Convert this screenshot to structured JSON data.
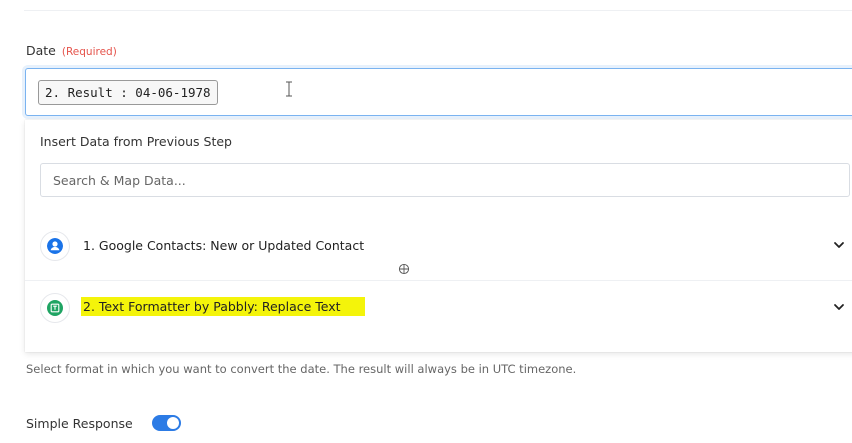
{
  "date_field": {
    "label": "Date",
    "required_text": "(Required)",
    "pill_value": "2. Result : 04-06-1978"
  },
  "dropdown": {
    "title": "Insert Data from Previous Step",
    "search_placeholder": "Search & Map Data...",
    "steps": [
      {
        "label": "1. Google Contacts: New or Updated Contact",
        "icon": "google-contacts-icon",
        "icon_color": "#1a73e8",
        "expanded": false
      },
      {
        "label": "2. Text Formatter by Pabbly: Replace Text",
        "icon": "text-formatter-icon",
        "icon_color": "#1fa463",
        "highlight_color": "#f4f40a",
        "expanded": false
      }
    ]
  },
  "help_text": "Select format in which you want to convert the date. The result will always be in UTC timezone.",
  "simple_response": {
    "label": "Simple Response",
    "enabled": true,
    "accent_color": "#2c7be5"
  }
}
